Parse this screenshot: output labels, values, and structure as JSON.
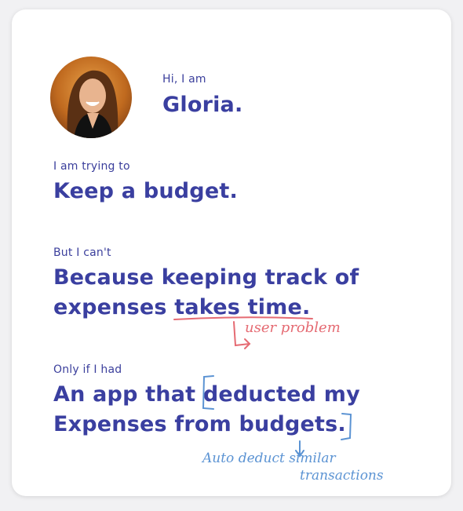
{
  "persona": {
    "intro_label": "Hi, I am",
    "name": "Gloria.",
    "goal_label": "I am trying to",
    "goal": "Keep a budget.",
    "obstacle_label": "But I can't",
    "obstacle_part1": "Because keeping track of expenses ",
    "obstacle_highlight": "takes time.",
    "wish_label": "Only if I had",
    "wish_part1": "An app that ",
    "wish_highlight1": "deducted",
    "wish_part2": " my Expenses from ",
    "wish_highlight2": "budgets."
  },
  "annotations": {
    "problem_note": "user problem",
    "solution_note_line1": "Auto deduct similar",
    "solution_note_line2": "transactions"
  },
  "colors": {
    "text": "#3a3fa0",
    "problem_annotation": "#e56b73",
    "solution_annotation": "#5b93d3"
  }
}
